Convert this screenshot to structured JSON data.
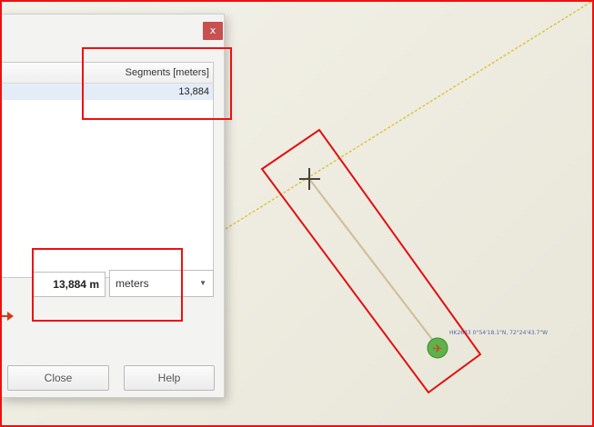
{
  "dialog": {
    "close_glyph": "x",
    "table": {
      "column_header": "Segments [meters]",
      "rows": [
        "13,884"
      ]
    },
    "total_value": "13,884 m",
    "unit_select": {
      "selected": "meters",
      "arrow_icon": "▼"
    },
    "buttons": {
      "close": "Close",
      "help": "Help"
    }
  },
  "map": {
    "aircraft_label": "HK2683 0°54'18.1\"N, 72°24'43.7\"W",
    "aircraft_icon": "✈",
    "colors": {
      "flight_path": "#d8c33a",
      "measure_line": "#cdb88e",
      "aircraft_marker": "#5fb24a",
      "annotation": "#e11111"
    }
  }
}
